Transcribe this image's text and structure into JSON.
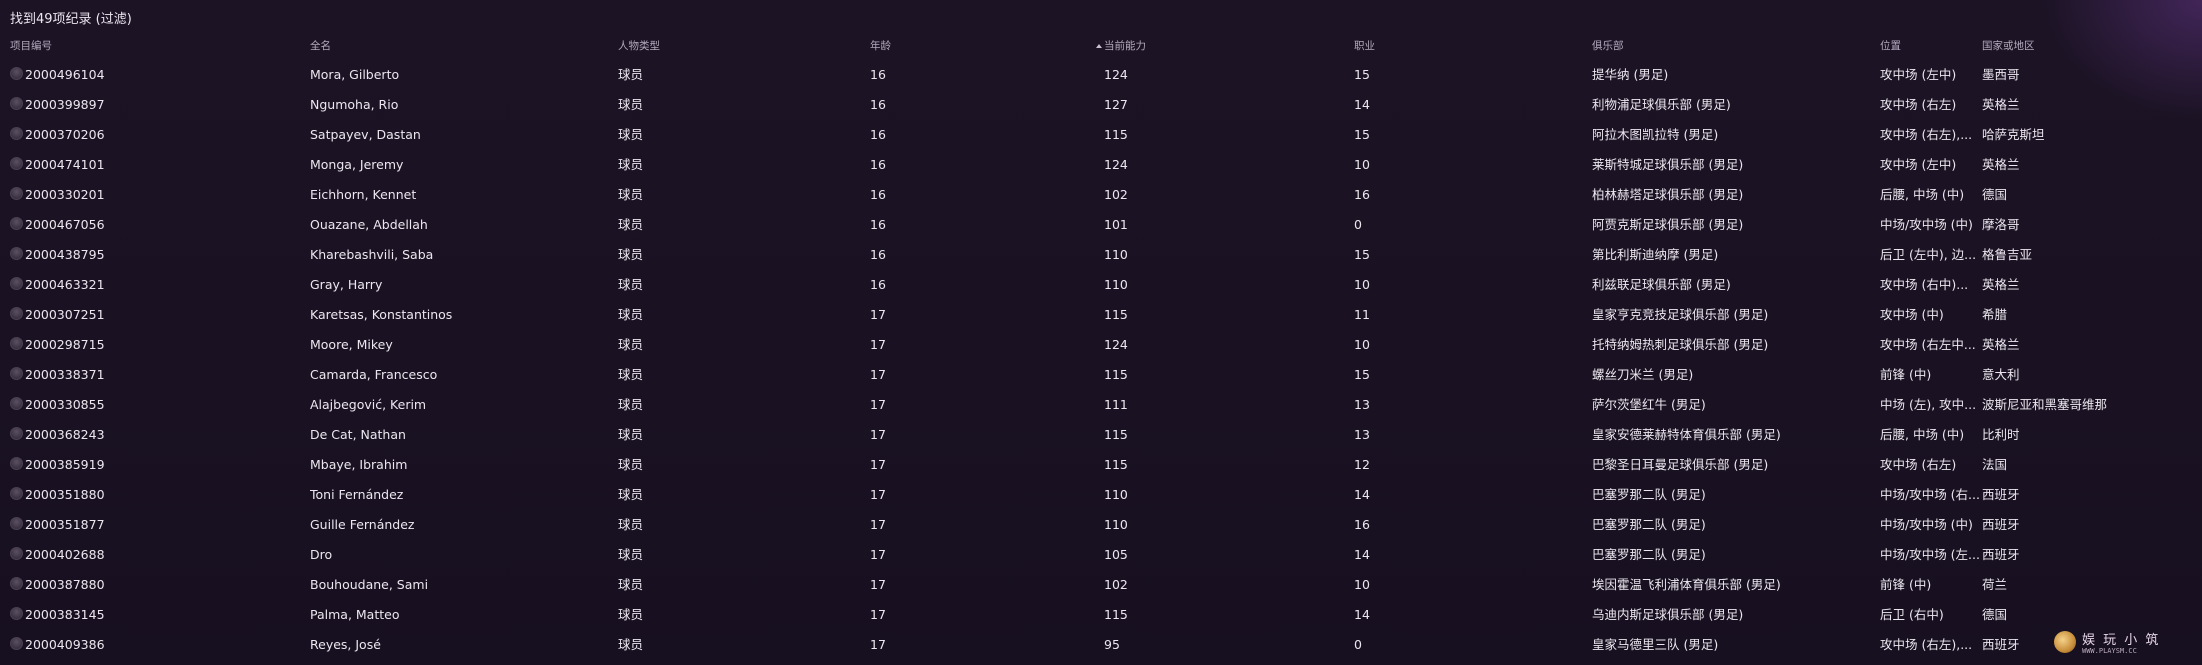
{
  "title": "找到49项纪录 (过滤)",
  "columns": {
    "id": "项目编号",
    "name": "全名",
    "type": "人物类型",
    "age": "年龄",
    "ca": "当前能力",
    "job": "职业",
    "club": "俱乐部",
    "position": "位置",
    "nation": "国家或地区"
  },
  "sort": {
    "column": "ca",
    "direction": "ascending",
    "icon": "sort-up-icon"
  },
  "rows": [
    {
      "id": "2000496104",
      "name": "Mora, Gilberto",
      "type": "球员",
      "age": "16",
      "ca": "124",
      "job": "15",
      "club": "提华纳 (男足)",
      "position": "攻中场 (左中)",
      "nation": "墨西哥"
    },
    {
      "id": "2000399897",
      "name": "Ngumoha, Rio",
      "type": "球员",
      "age": "16",
      "ca": "127",
      "job": "14",
      "club": "利物浦足球俱乐部 (男足)",
      "position": "攻中场 (右左)",
      "nation": "英格兰"
    },
    {
      "id": "2000370206",
      "name": "Satpayev, Dastan",
      "type": "球员",
      "age": "16",
      "ca": "115",
      "job": "15",
      "club": "阿拉木图凯拉特 (男足)",
      "position": "攻中场 (右左),...",
      "nation": "哈萨克斯坦"
    },
    {
      "id": "2000474101",
      "name": "Monga, Jeremy",
      "type": "球员",
      "age": "16",
      "ca": "124",
      "job": "10",
      "club": "莱斯特城足球俱乐部 (男足)",
      "position": "攻中场 (左中)",
      "nation": "英格兰"
    },
    {
      "id": "2000330201",
      "name": "Eichhorn, Kennet",
      "type": "球员",
      "age": "16",
      "ca": "102",
      "job": "16",
      "club": "柏林赫塔足球俱乐部 (男足)",
      "position": "后腰, 中场 (中)",
      "nation": "德国"
    },
    {
      "id": "2000467056",
      "name": "Ouazane, Abdellah",
      "type": "球员",
      "age": "16",
      "ca": "101",
      "job": "0",
      "club": "阿贾克斯足球俱乐部 (男足)",
      "position": "中场/攻中场 (中)",
      "nation": "摩洛哥"
    },
    {
      "id": "2000438795",
      "name": "Kharebashvili, Saba",
      "type": "球员",
      "age": "16",
      "ca": "110",
      "job": "15",
      "club": "第比利斯迪纳摩 (男足)",
      "position": "后卫 (左中), 边...",
      "nation": "格鲁吉亚"
    },
    {
      "id": "2000463321",
      "name": "Gray, Harry",
      "type": "球员",
      "age": "16",
      "ca": "110",
      "job": "10",
      "club": "利兹联足球俱乐部 (男足)",
      "position": "攻中场 (右中)...",
      "nation": "英格兰"
    },
    {
      "id": "2000307251",
      "name": "Karetsas, Konstantinos",
      "type": "球员",
      "age": "17",
      "ca": "115",
      "job": "11",
      "club": "皇家亨克竞技足球俱乐部 (男足)",
      "position": "攻中场 (中)",
      "nation": "希腊"
    },
    {
      "id": "2000298715",
      "name": "Moore, Mikey",
      "type": "球员",
      "age": "17",
      "ca": "124",
      "job": "10",
      "club": "托特纳姆热刺足球俱乐部 (男足)",
      "position": "攻中场 (右左中...",
      "nation": "英格兰"
    },
    {
      "id": "2000338371",
      "name": "Camarda, Francesco",
      "type": "球员",
      "age": "17",
      "ca": "115",
      "job": "15",
      "club": "螺丝刀米兰 (男足)",
      "position": "前锋 (中)",
      "nation": "意大利"
    },
    {
      "id": "2000330855",
      "name": "Alajbegović, Kerim",
      "type": "球员",
      "age": "17",
      "ca": "111",
      "job": "13",
      "club": "萨尔茨堡红牛 (男足)",
      "position": "中场 (左), 攻中...",
      "nation": "波斯尼亚和黑塞哥维那"
    },
    {
      "id": "2000368243",
      "name": "De Cat, Nathan",
      "type": "球员",
      "age": "17",
      "ca": "115",
      "job": "13",
      "club": "皇家安德莱赫特体育俱乐部 (男足)",
      "position": "后腰, 中场 (中)",
      "nation": "比利时"
    },
    {
      "id": "2000385919",
      "name": "Mbaye, Ibrahim",
      "type": "球员",
      "age": "17",
      "ca": "115",
      "job": "12",
      "club": "巴黎圣日耳曼足球俱乐部 (男足)",
      "position": "攻中场 (右左)",
      "nation": "法国"
    },
    {
      "id": "2000351880",
      "name": "Toni Fernández",
      "type": "球员",
      "age": "17",
      "ca": "110",
      "job": "14",
      "club": "巴塞罗那二队 (男足)",
      "position": "中场/攻中场 (右...",
      "nation": "西班牙"
    },
    {
      "id": "2000351877",
      "name": "Guille Fernández",
      "type": "球员",
      "age": "17",
      "ca": "110",
      "job": "16",
      "club": "巴塞罗那二队 (男足)",
      "position": "中场/攻中场 (中)",
      "nation": "西班牙"
    },
    {
      "id": "2000402688",
      "name": "Dro",
      "type": "球员",
      "age": "17",
      "ca": "105",
      "job": "14",
      "club": "巴塞罗那二队 (男足)",
      "position": "中场/攻中场 (左...",
      "nation": "西班牙"
    },
    {
      "id": "2000387880",
      "name": "Bouhoudane, Sami",
      "type": "球员",
      "age": "17",
      "ca": "102",
      "job": "10",
      "club": "埃因霍温飞利浦体育俱乐部 (男足)",
      "position": "前锋 (中)",
      "nation": "荷兰"
    },
    {
      "id": "2000383145",
      "name": "Palma, Matteo",
      "type": "球员",
      "age": "17",
      "ca": "115",
      "job": "14",
      "club": "乌迪内斯足球俱乐部 (男足)",
      "position": "后卫 (右中)",
      "nation": "德国"
    },
    {
      "id": "2000409386",
      "name": "Reyes, José",
      "type": "球员",
      "age": "17",
      "ca": "95",
      "job": "0",
      "club": "皇家马德里三队 (男足)",
      "position": "攻中场 (右左),...",
      "nation": "西班牙"
    }
  ],
  "watermark": {
    "text": "娱 玩 小 筑",
    "sub": "WWW.PLAYSM.CC",
    "icon": "site-logo-icon"
  }
}
